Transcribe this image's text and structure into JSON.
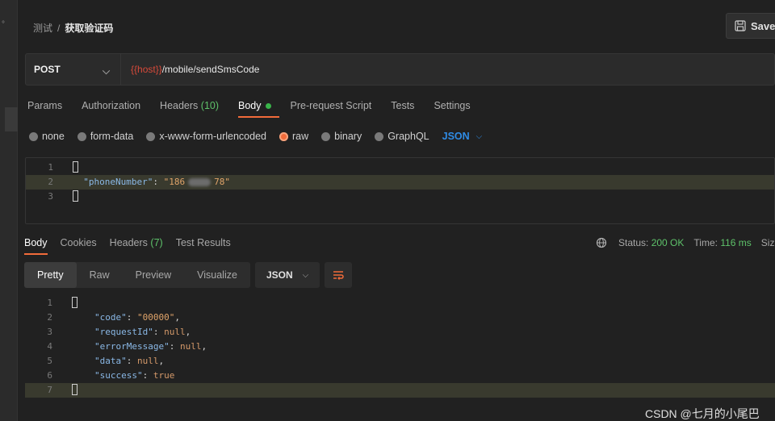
{
  "breadcrumb": {
    "parent": "测试",
    "separator": "/",
    "current": "获取验证码"
  },
  "toolbar": {
    "save_label": "Save"
  },
  "request": {
    "method": "POST",
    "url_var": "{{host}}",
    "url_path": "/mobile/sendSmsCode"
  },
  "request_tabs": [
    {
      "label": "Params"
    },
    {
      "label": "Authorization"
    },
    {
      "label": "Headers",
      "count": "(10)"
    },
    {
      "label": "Body",
      "active": true
    },
    {
      "label": "Pre-request Script"
    },
    {
      "label": "Tests"
    },
    {
      "label": "Settings"
    }
  ],
  "body_types": [
    {
      "label": "none"
    },
    {
      "label": "form-data"
    },
    {
      "label": "x-www-form-urlencoded"
    },
    {
      "label": "raw",
      "active": true
    },
    {
      "label": "binary"
    },
    {
      "label": "GraphQL"
    }
  ],
  "body_format": "JSON",
  "request_body": {
    "line_numbers": [
      "1",
      "2",
      "3"
    ],
    "open": "{",
    "key": "\"phoneNumber\"",
    "colon": ": ",
    "value_start": "\"186",
    "value_end": "78\"",
    "close": "}"
  },
  "response_tabs": [
    {
      "label": "Body",
      "active": true
    },
    {
      "label": "Cookies"
    },
    {
      "label": "Headers",
      "count": "(7)"
    },
    {
      "label": "Test Results"
    }
  ],
  "status": {
    "status_label": "Status:",
    "status_value": "200 OK",
    "time_label": "Time:",
    "time_value": "116 ms",
    "size_label": "Siz"
  },
  "view_tabs": [
    {
      "label": "Pretty",
      "active": true
    },
    {
      "label": "Raw"
    },
    {
      "label": "Preview"
    },
    {
      "label": "Visualize"
    }
  ],
  "response_format": "JSON",
  "response_body": {
    "line_numbers": [
      "1",
      "2",
      "3",
      "4",
      "5",
      "6",
      "7"
    ],
    "lines": [
      {
        "key": "\"code\"",
        "value": "\"00000\"",
        "vtype": "str",
        "comma": ","
      },
      {
        "key": "\"requestId\"",
        "value": "null",
        "vtype": "kw",
        "comma": ","
      },
      {
        "key": "\"errorMessage\"",
        "value": "null",
        "vtype": "kw",
        "comma": ","
      },
      {
        "key": "\"data\"",
        "value": "null",
        "vtype": "kw",
        "comma": ","
      },
      {
        "key": "\"success\"",
        "value": "true",
        "vtype": "kw",
        "comma": ""
      }
    ]
  },
  "watermark": "CSDN @七月的小尾巴",
  "colors": {
    "accent": "#f26b3a",
    "success": "#5ec26a",
    "link": "#2f8ce6",
    "variable": "#d94a3a"
  }
}
